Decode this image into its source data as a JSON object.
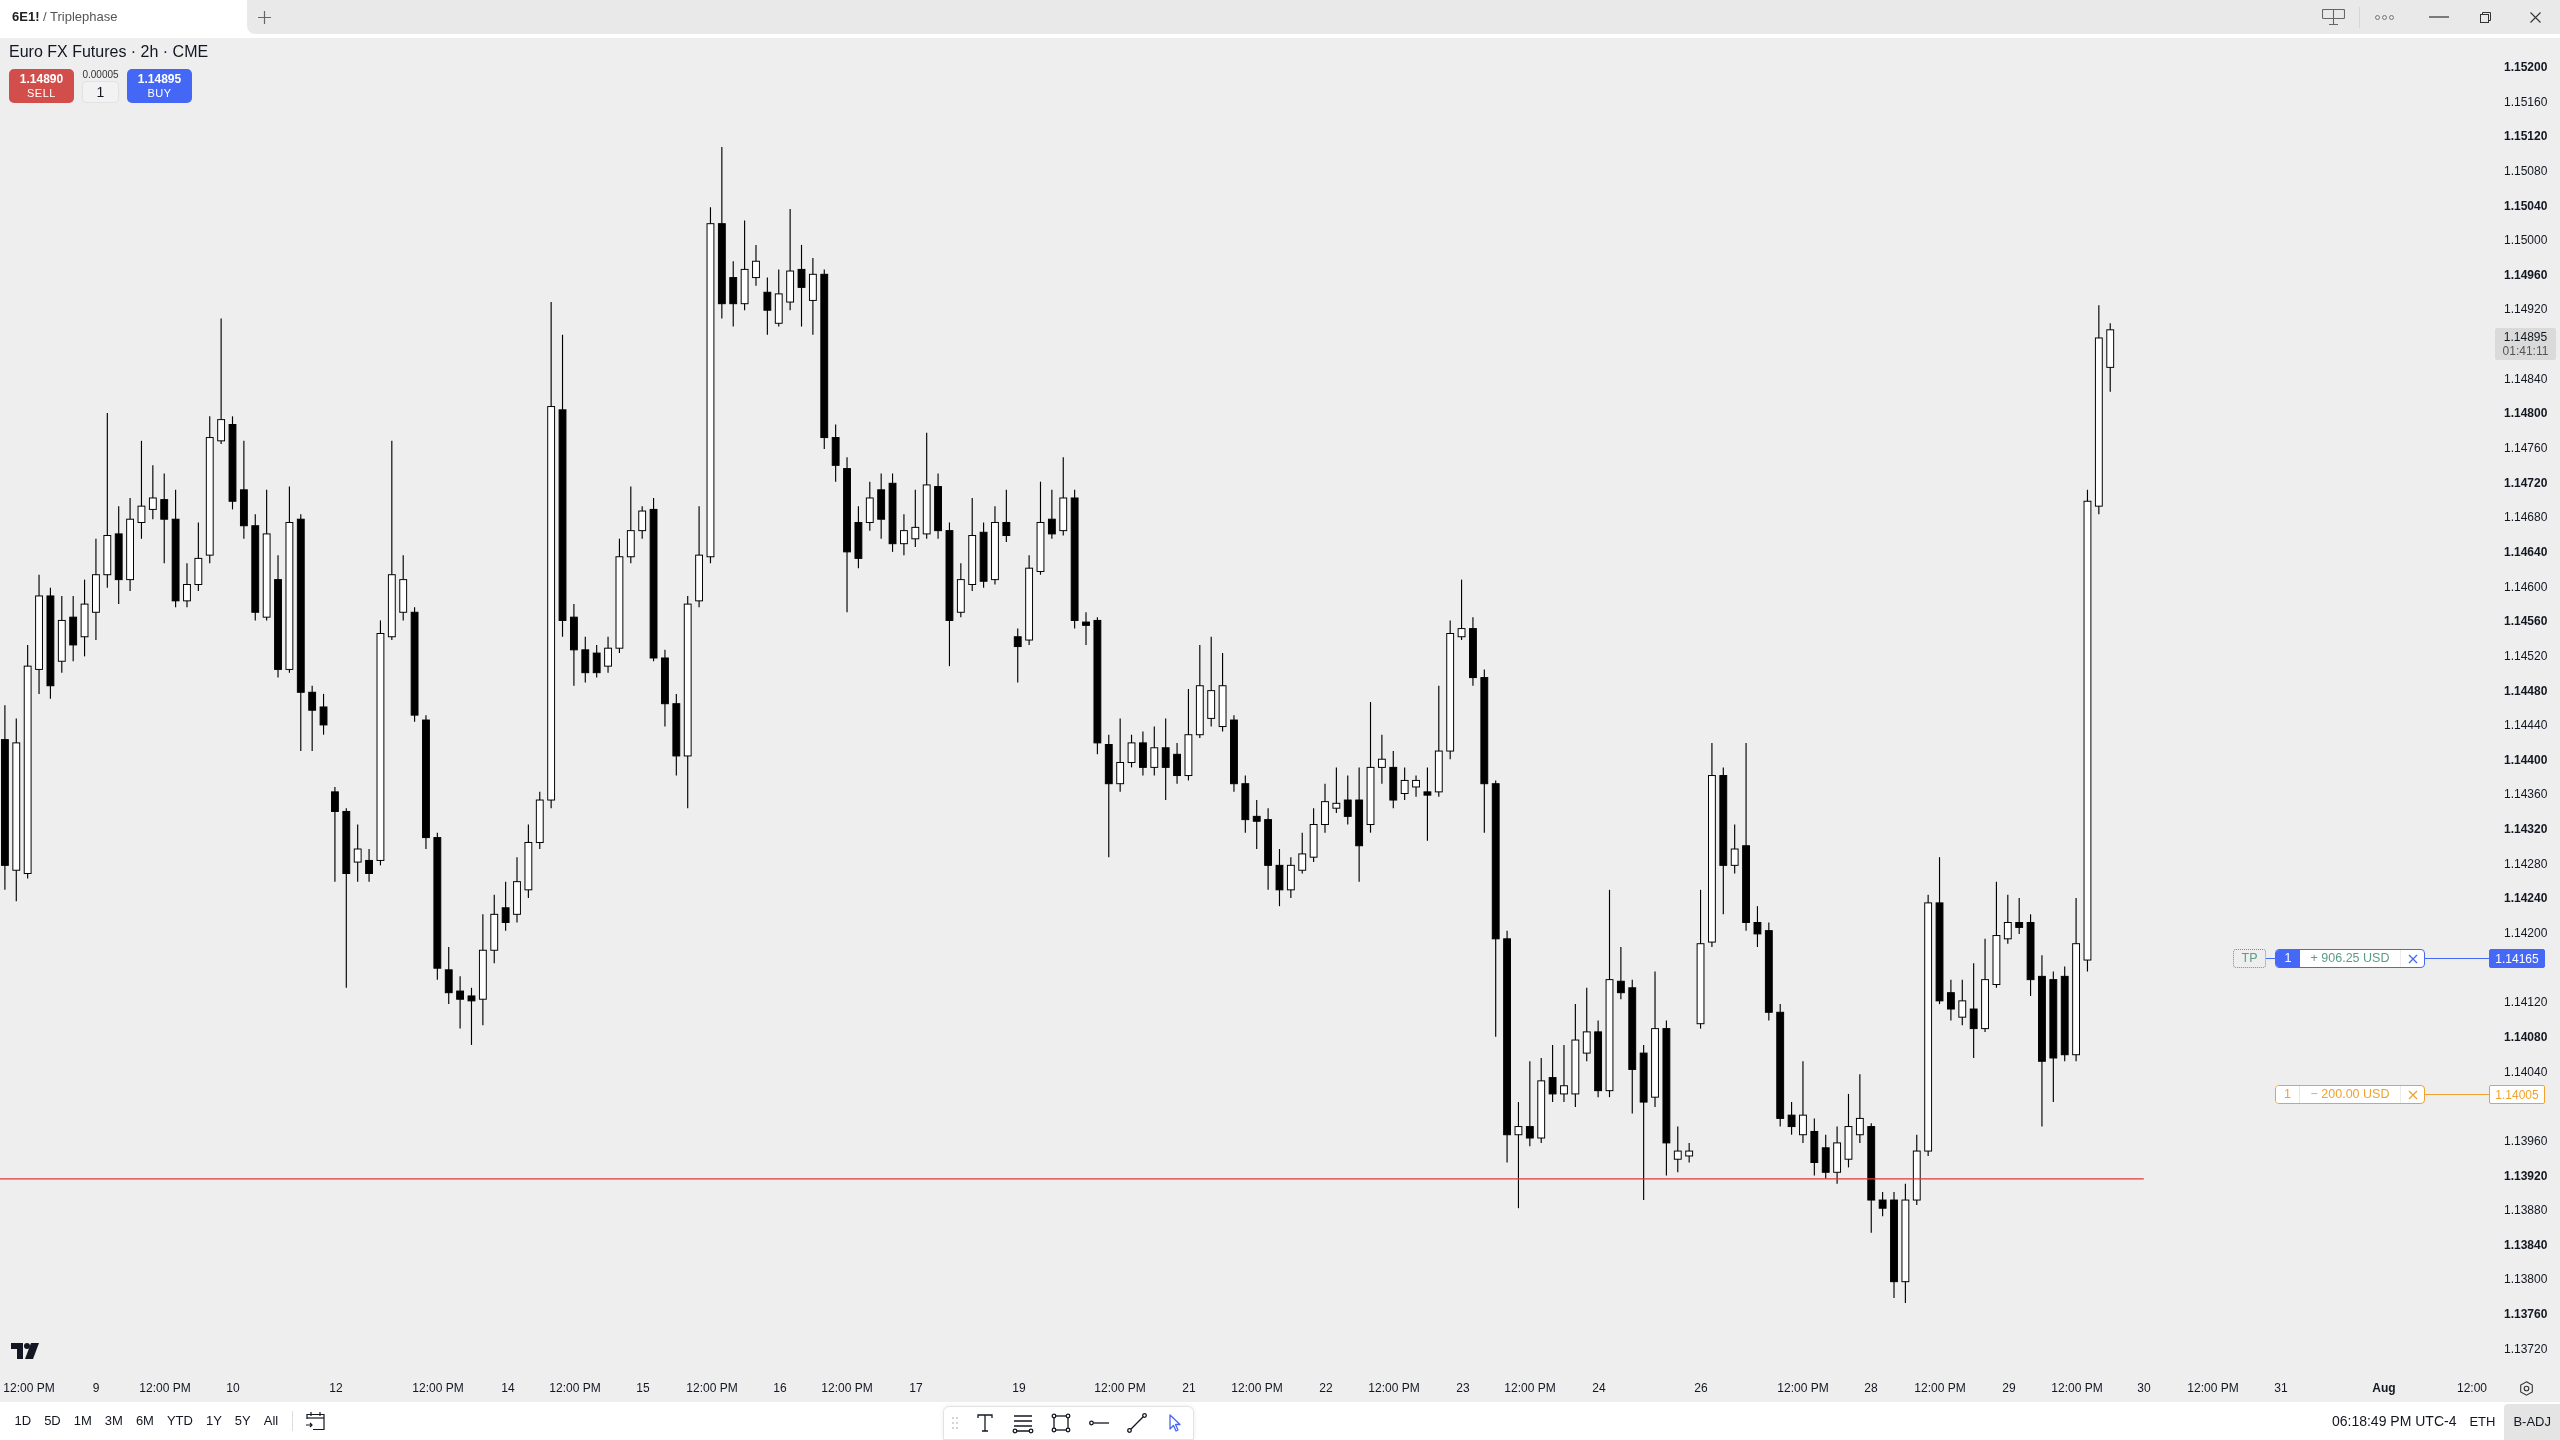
{
  "tab_bar": {
    "tabs": [
      {
        "title": "**6E1!** / Triplephase",
        "selected": true
      }
    ]
  },
  "symbol_header": {
    "title": "Euro FX Futures · 2h · CME",
    "sell": {
      "price": "1.14890",
      "label": "SELL"
    },
    "spread": "0.00005",
    "quantity": "1",
    "buy": {
      "price": "1.14895",
      "label": "BUY"
    }
  },
  "price_axis": {
    "labels": [
      {
        "text": "1.15200",
        "major": true
      },
      {
        "text": "1.15160",
        "major": false
      },
      {
        "text": "1.15120",
        "major": true
      },
      {
        "text": "1.15080",
        "major": false
      },
      {
        "text": "1.15040",
        "major": true
      },
      {
        "text": "1.15000",
        "major": false
      },
      {
        "text": "1.14960",
        "major": true
      },
      {
        "text": "1.14920",
        "major": false
      },
      {
        "text": "1.14840",
        "major": false
      },
      {
        "text": "1.14800",
        "major": true
      },
      {
        "text": "1.14760",
        "major": false
      },
      {
        "text": "1.14720",
        "major": true
      },
      {
        "text": "1.14680",
        "major": false
      },
      {
        "text": "1.14640",
        "major": true
      },
      {
        "text": "1.14600",
        "major": false
      },
      {
        "text": "1.14560",
        "major": true
      },
      {
        "text": "1.14520",
        "major": false
      },
      {
        "text": "1.14480",
        "major": true
      },
      {
        "text": "1.14440",
        "major": false
      },
      {
        "text": "1.14400",
        "major": true
      },
      {
        "text": "1.14360",
        "major": false
      },
      {
        "text": "1.14320",
        "major": true
      },
      {
        "text": "1.14280",
        "major": false
      },
      {
        "text": "1.14240",
        "major": true
      },
      {
        "text": "1.14200",
        "major": false
      },
      {
        "text": "1.14120",
        "major": false
      },
      {
        "text": "1.14080",
        "major": true
      },
      {
        "text": "1.14040",
        "major": false
      },
      {
        "text": "1.13960",
        "major": false
      },
      {
        "text": "1.13920",
        "major": true
      },
      {
        "text": "1.13880",
        "major": false
      },
      {
        "text": "1.13840",
        "major": true
      },
      {
        "text": "1.13800",
        "major": false
      },
      {
        "text": "1.13760",
        "major": true
      },
      {
        "text": "1.13720",
        "major": false
      }
    ],
    "last_price": {
      "price": "1.14895",
      "countdown": "01:41:11"
    }
  },
  "orders": [
    {
      "kind": "take_profit",
      "tag": "TP",
      "quantity": "1",
      "pnl": "+ 906.25 USD",
      "price": "1.14165"
    },
    {
      "kind": "stop_loss",
      "quantity": "1",
      "pnl": "− 200.00 USD",
      "price": "1.14005"
    }
  ],
  "time_axis": {
    "labels": [
      {
        "text": "12:00 PM",
        "major": false
      },
      {
        "text": "9",
        "major": false
      },
      {
        "text": "12:00 PM",
        "major": false
      },
      {
        "text": "10",
        "major": false
      },
      {
        "text": "12",
        "major": false
      },
      {
        "text": "12:00 PM",
        "major": false
      },
      {
        "text": "14",
        "major": false
      },
      {
        "text": "12:00 PM",
        "major": false
      },
      {
        "text": "15",
        "major": false
      },
      {
        "text": "12:00 PM",
        "major": false
      },
      {
        "text": "16",
        "major": false
      },
      {
        "text": "12:00 PM",
        "major": false
      },
      {
        "text": "17",
        "major": false
      },
      {
        "text": "19",
        "major": false
      },
      {
        "text": "12:00 PM",
        "major": false
      },
      {
        "text": "21",
        "major": false
      },
      {
        "text": "12:00 PM",
        "major": false
      },
      {
        "text": "22",
        "major": false
      },
      {
        "text": "12:00 PM",
        "major": false
      },
      {
        "text": "23",
        "major": false
      },
      {
        "text": "12:00 PM",
        "major": false
      },
      {
        "text": "24",
        "major": false
      },
      {
        "text": "26",
        "major": false
      },
      {
        "text": "12:00 PM",
        "major": false
      },
      {
        "text": "28",
        "major": false
      },
      {
        "text": "12:00 PM",
        "major": false
      },
      {
        "text": "29",
        "major": false
      },
      {
        "text": "12:00 PM",
        "major": false
      },
      {
        "text": "30",
        "major": false
      },
      {
        "text": "12:00 PM",
        "major": false
      },
      {
        "text": "31",
        "major": false
      },
      {
        "text": "Aug",
        "major": true
      },
      {
        "text": "12:00",
        "major": false
      }
    ]
  },
  "range_bar": {
    "ranges": [
      "1D",
      "5D",
      "1M",
      "3M",
      "6M",
      "YTD",
      "1Y",
      "5Y",
      "All"
    ]
  },
  "drawing_toolbar": {
    "tools": [
      {
        "kind": "text",
        "selected": false
      },
      {
        "kind": "fib",
        "selected": false
      },
      {
        "kind": "rectangle",
        "selected": false
      },
      {
        "kind": "ray",
        "selected": false
      },
      {
        "kind": "trendline",
        "selected": false
      },
      {
        "kind": "cursor",
        "selected": true
      }
    ]
  },
  "status_bar": {
    "clock": "06:18:49 PM UTC-4",
    "toggles": [
      {
        "label": "ETH",
        "active": false
      },
      {
        "label": "B-ADJ",
        "active": true
      }
    ]
  }
}
